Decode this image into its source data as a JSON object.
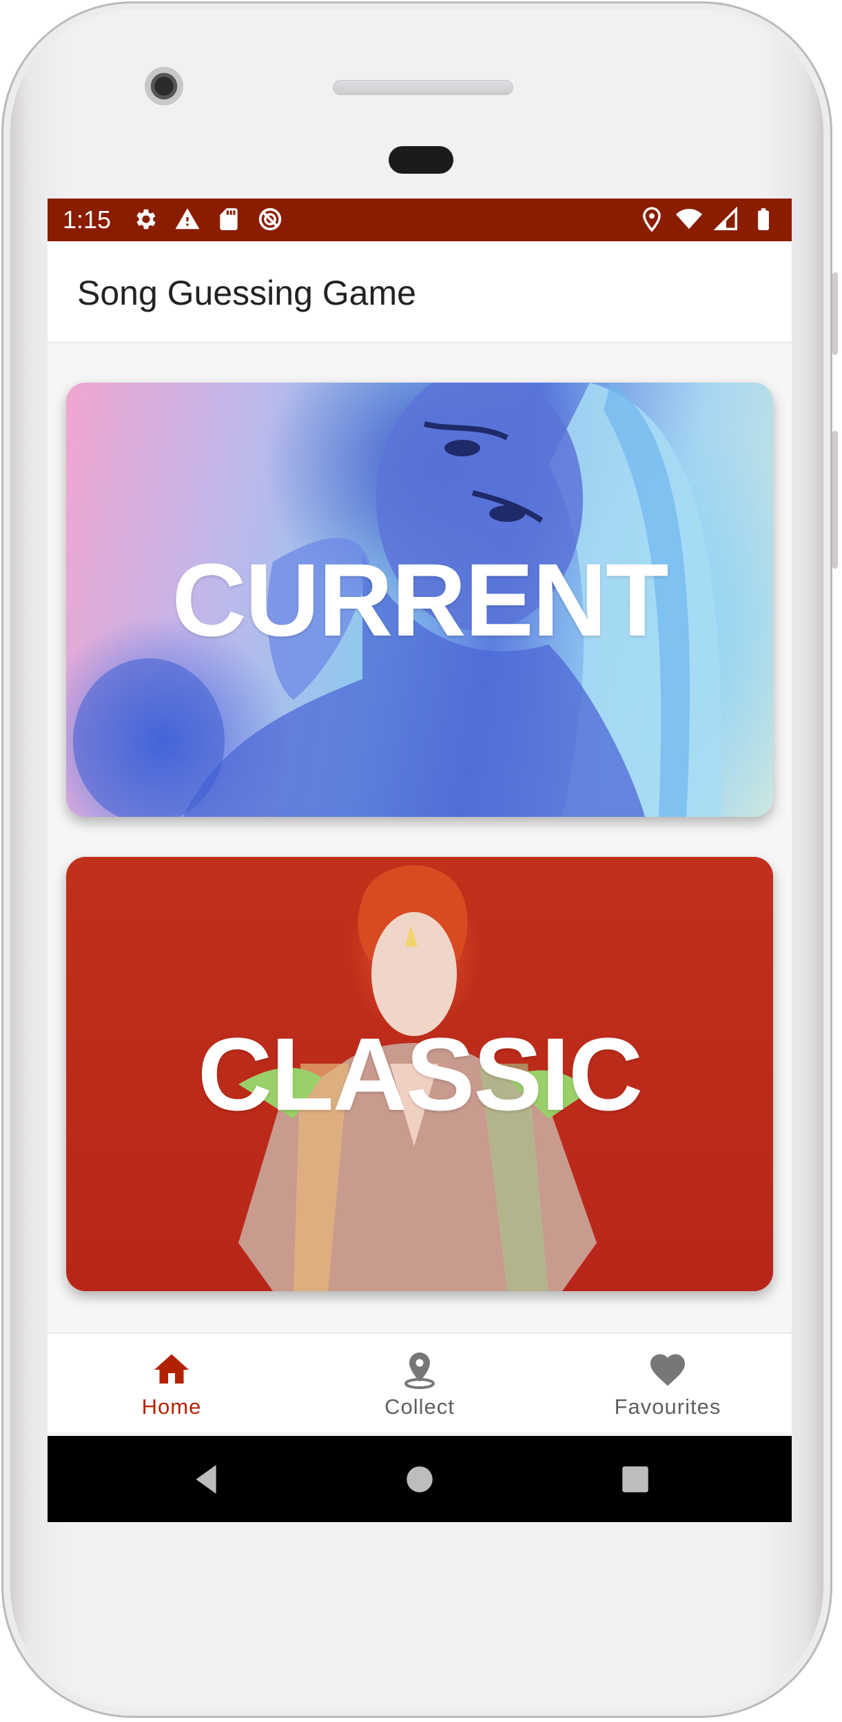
{
  "status_bar": {
    "time": "1:15",
    "left_icons": [
      "gear-icon",
      "warning-icon",
      "sd-card-icon",
      "no-disturb-icon"
    ],
    "right_icons": [
      "location-icon",
      "wifi-icon",
      "signal-icon",
      "battery-icon"
    ],
    "color": "#8a1c00"
  },
  "app_bar": {
    "title": "Song Guessing Game"
  },
  "cards": [
    {
      "label": "CURRENT",
      "image": "woman-blue-glitter-portrait"
    },
    {
      "label": "CLASSIC",
      "image": "glam-rock-singer-red-background"
    }
  ],
  "bottom_nav": {
    "active_color": "#b32200",
    "inactive_color": "#5f5f5f",
    "items": [
      {
        "label": "Home",
        "icon": "home-icon",
        "active": true
      },
      {
        "label": "Collect",
        "icon": "map-pin-icon",
        "active": false
      },
      {
        "label": "Favourites",
        "icon": "heart-icon",
        "active": false
      }
    ]
  },
  "system_nav": {
    "buttons": [
      "back-icon",
      "home-circle-icon",
      "recents-icon"
    ]
  }
}
